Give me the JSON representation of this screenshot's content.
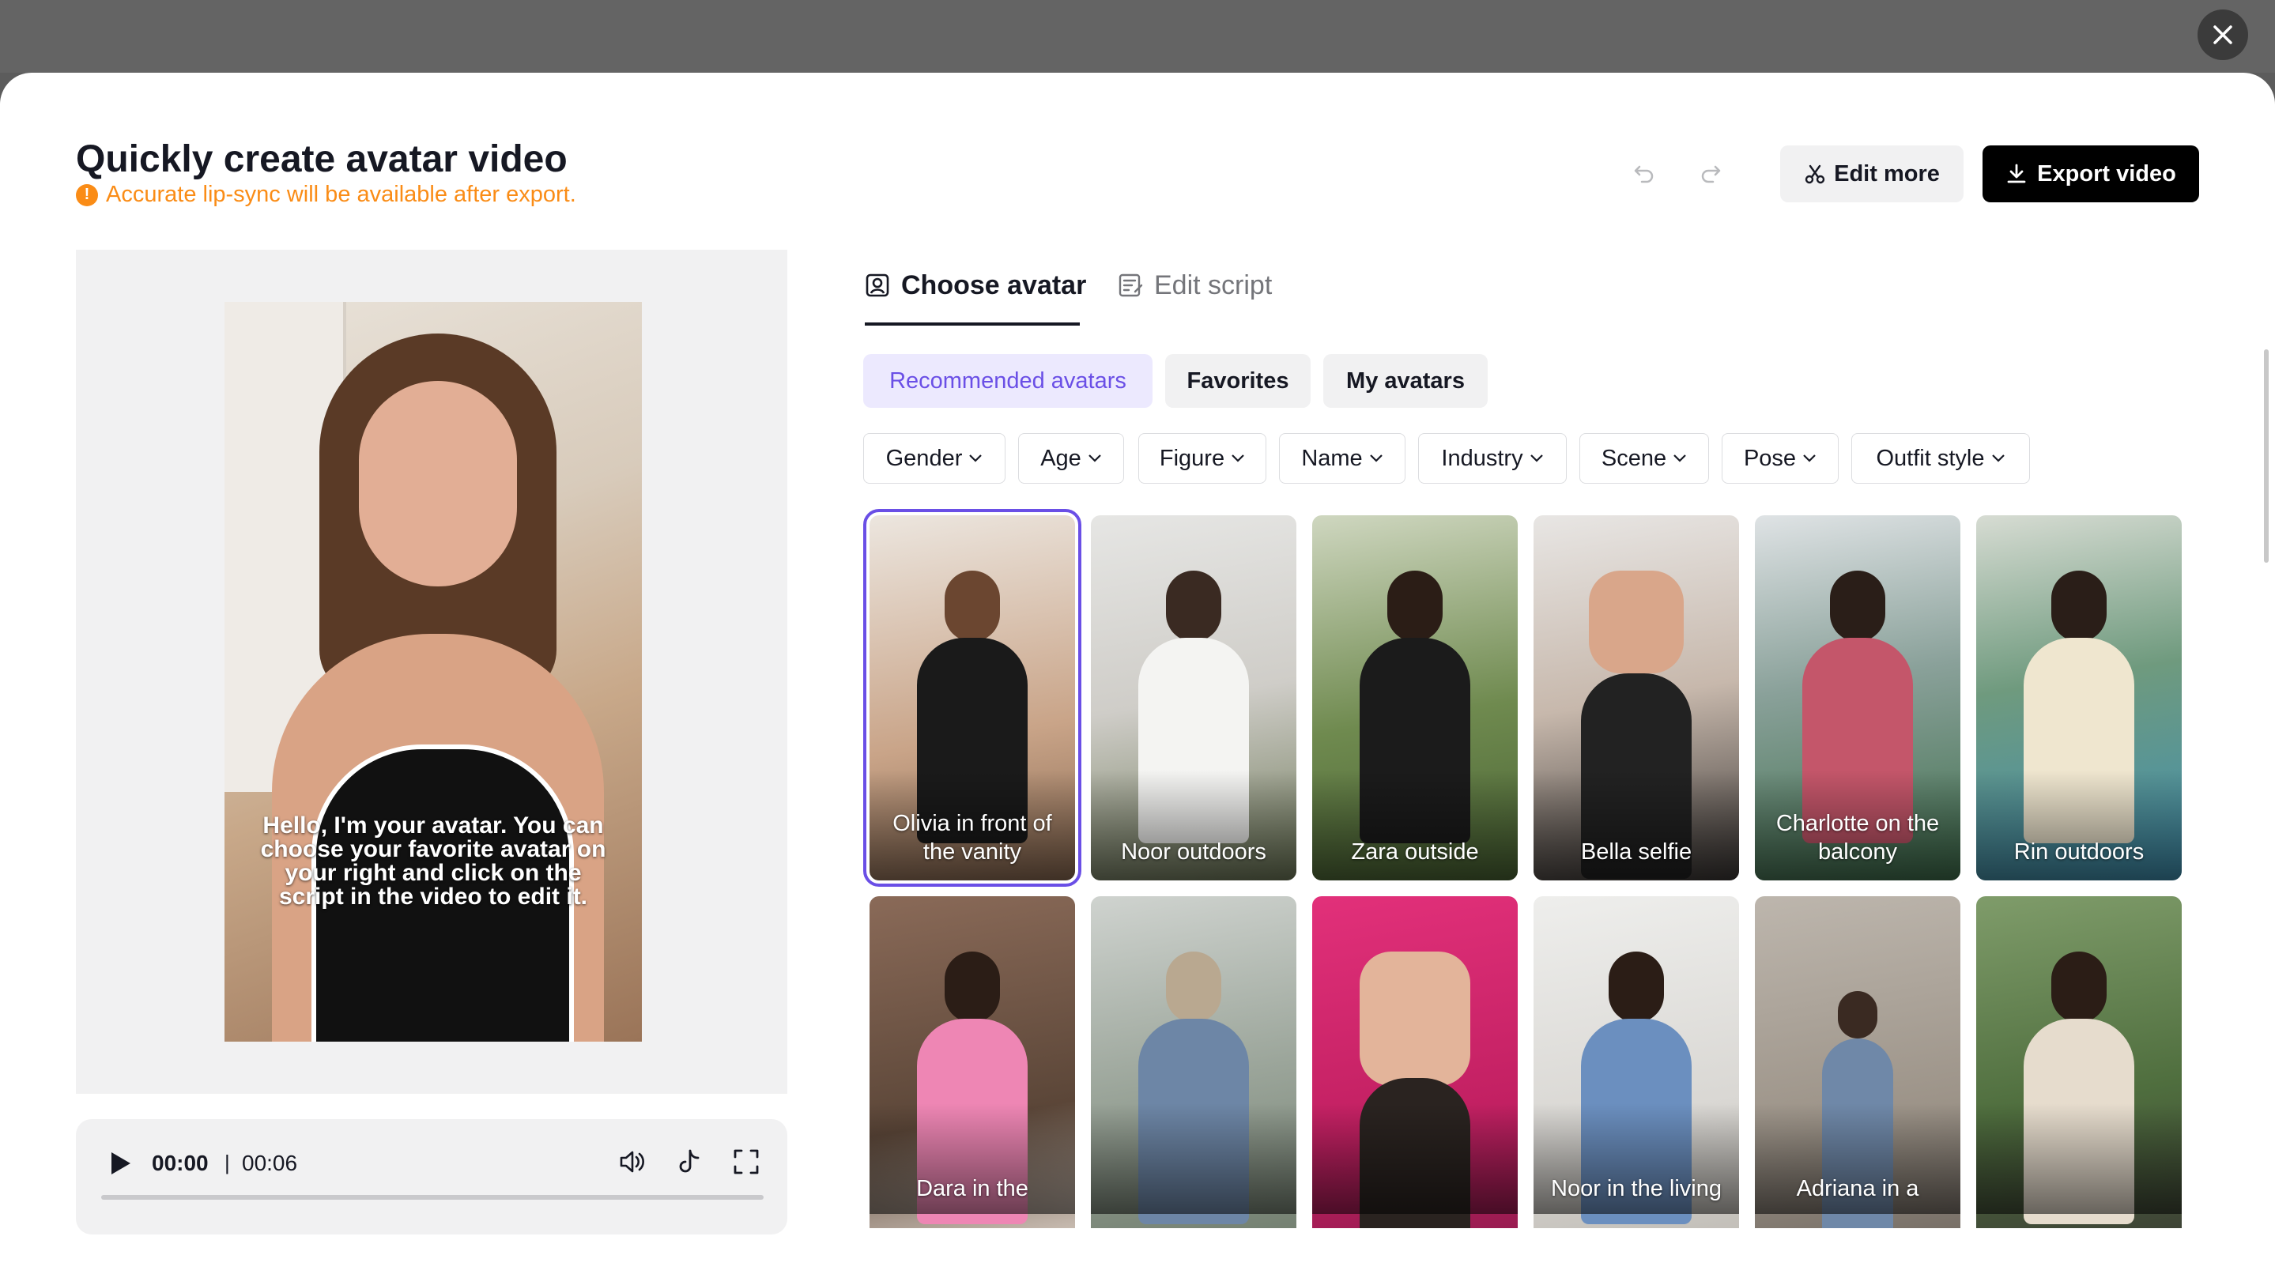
{
  "modal": {
    "title": "Quickly create avatar video",
    "notice": "Accurate lip-sync will be available after export.",
    "edit_more_label": "Edit more",
    "export_label": "Export video"
  },
  "preview": {
    "caption": "Hello, I'm your avatar. You can choose your favorite avatar on your right and click on the script in the video to edit it.",
    "time_current": "00:00",
    "time_separator": "|",
    "time_total": "00:06",
    "progress": 0
  },
  "tabs": [
    {
      "label": "Choose avatar",
      "active": true,
      "icon": "avatar-icon"
    },
    {
      "label": "Edit script",
      "active": false,
      "icon": "script-icon"
    }
  ],
  "categories": [
    {
      "label": "Recommended avatars",
      "active": true
    },
    {
      "label": "Favorites",
      "active": false
    },
    {
      "label": "My avatars",
      "active": false
    }
  ],
  "filters": [
    "Gender",
    "Age",
    "Figure",
    "Name",
    "Industry",
    "Scene",
    "Pose",
    "Outfit style"
  ],
  "avatars": [
    {
      "label": "Olivia in front of the vanity",
      "selected": true
    },
    {
      "label": "Noor outdoors",
      "selected": false
    },
    {
      "label": "Zara outside",
      "selected": false
    },
    {
      "label": "Bella selfie",
      "selected": false
    },
    {
      "label": "Charlotte on the balcony",
      "selected": false
    },
    {
      "label": "Rin outdoors",
      "selected": false
    },
    {
      "label": "Dara in the",
      "selected": false
    },
    {
      "label": "",
      "selected": false
    },
    {
      "label": "",
      "selected": false
    },
    {
      "label": "Noor in the living",
      "selected": false
    },
    {
      "label": "Adriana in a",
      "selected": false
    },
    {
      "label": "",
      "selected": false
    }
  ],
  "colors": {
    "accent": "#6a4fe6",
    "warning": "#fa8c16",
    "primary_button": "#000000"
  }
}
